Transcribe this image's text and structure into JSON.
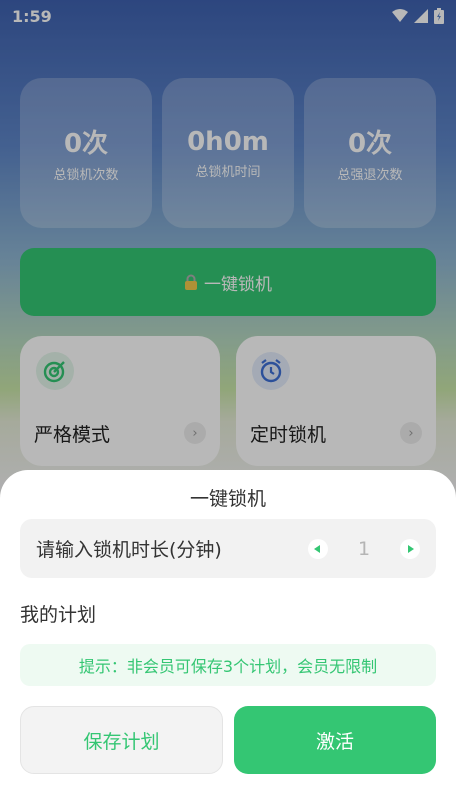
{
  "status_bar": {
    "time": "1:59"
  },
  "stats": [
    {
      "value": "0次",
      "label": "总锁机次数"
    },
    {
      "value": "0h0m",
      "label": "总锁机时间"
    },
    {
      "value": "0次",
      "label": "总强退次数"
    }
  ],
  "lock_button": {
    "label": "一键锁机"
  },
  "modes": [
    {
      "label": "严格模式",
      "icon": "target-icon"
    },
    {
      "label": "定时锁机",
      "icon": "alarm-clock-icon"
    }
  ],
  "sheet": {
    "title": "一键锁机",
    "duration_label": "请输入锁机时长(分钟)",
    "duration_value": "1",
    "plans_title": "我的计划",
    "tip": "提示：非会员可保存3个计划，会员无限制",
    "save_label": "保存计划",
    "activate_label": "激活"
  },
  "colors": {
    "accent": "#34c673",
    "tip_bg": "#eefaf2"
  }
}
